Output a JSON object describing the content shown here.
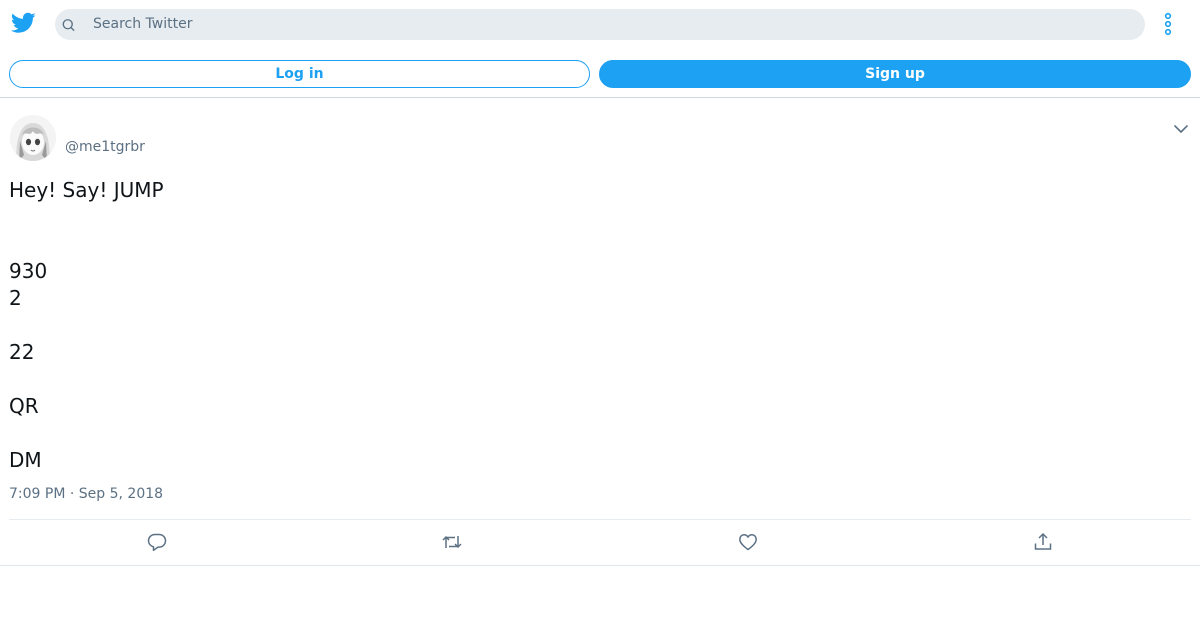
{
  "header": {
    "logo_icon": "twitter-bird-icon",
    "search_placeholder": "Search Twitter",
    "more_icon": "vertical-dots-icon"
  },
  "auth": {
    "login_label": "Log in",
    "signup_label": "Sign up"
  },
  "colors": {
    "brand": "#1da1f2",
    "muted_text": "#5b7083",
    "search_bg": "#e6ecf0"
  },
  "tweet": {
    "handle": "@me1tgrbr",
    "lines": [
      "Hey! Say! JUMP",
      "",
      "",
      "930",
      "2",
      "",
      "22",
      "",
      "QR",
      "",
      "DM"
    ],
    "timestamp": "7:09 PM · Sep 5, 2018",
    "actions": [
      "reply-icon",
      "retweet-icon",
      "like-icon",
      "share-icon"
    ]
  }
}
